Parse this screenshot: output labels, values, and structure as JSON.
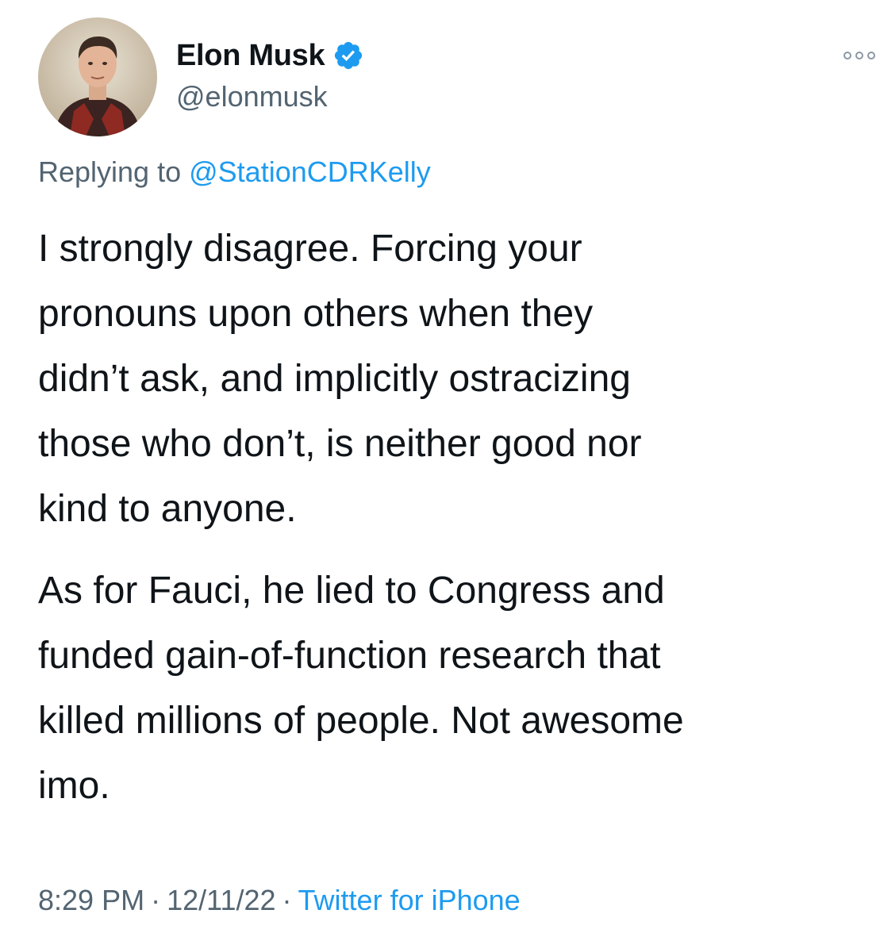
{
  "author": {
    "name": "Elon Musk",
    "handle": "@elonmusk",
    "verified_color": "#1d9bf0"
  },
  "more_icon": "ellipsis-icon",
  "reply": {
    "prefix": "Replying to",
    "to_handle": "@StationCDRKelly"
  },
  "body": {
    "paragraph1_lines": [
      "I strongly disagree. Forcing your",
      "pronouns upon others when they",
      "didn’t ask, and implicitly ostracizing",
      "those who don’t, is neither good nor",
      "kind to anyone."
    ],
    "paragraph2_lines": [
      "As for Fauci, he lied to Congress and",
      "funded gain-of-function research that",
      "killed millions of people. Not awesome",
      "imo."
    ]
  },
  "meta": {
    "time": "8:29 PM",
    "date": "12/11/22",
    "separator": "·",
    "source": "Twitter for iPhone"
  },
  "colors": {
    "text": "#0f1419",
    "secondary": "#536471",
    "link": "#1d9bf0"
  }
}
